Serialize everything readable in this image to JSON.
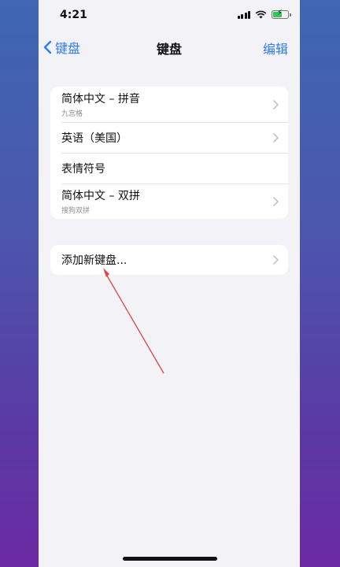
{
  "status_bar": {
    "time": "4:21"
  },
  "nav": {
    "back_label": "键盘",
    "title": "键盘",
    "edit_label": "编辑"
  },
  "keyboards": [
    {
      "title": "简体中文 – 拼音",
      "subtitle": "九宫格"
    },
    {
      "title": "英语（美国）",
      "subtitle": ""
    },
    {
      "title": "表情符号",
      "subtitle": ""
    },
    {
      "title": "简体中文 – 双拼",
      "subtitle": "搜狗双拼"
    }
  ],
  "add_keyboard": {
    "label": "添加新键盘..."
  },
  "colors": {
    "accent": "#2f7cf6",
    "annotation_arrow": "#d94848",
    "battery": "#34c759"
  }
}
